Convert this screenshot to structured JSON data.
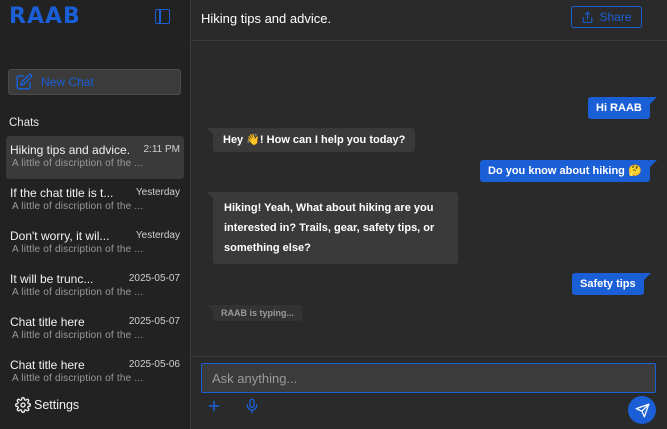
{
  "app": {
    "logo": "RAAB"
  },
  "sidebar": {
    "new_chat_label": "New Chat",
    "chats_heading": "Chats",
    "chats": [
      {
        "title": "Hiking tips and advice.",
        "time": "2:11 PM",
        "desc": "A little of discription of the ..."
      },
      {
        "title": "If the chat title is t...",
        "time": "Yesterday",
        "desc": "A little of discription of the ..."
      },
      {
        "title": "Don't worry, it wil...",
        "time": "Yesterday",
        "desc": "A little of discription of the ..."
      },
      {
        "title": "It will be trunc...",
        "time": "2025-05-07",
        "desc": "A little of discription of the ..."
      },
      {
        "title": "Chat title here",
        "time": "2025-05-07",
        "desc": "A little of discription of the ..."
      },
      {
        "title": "Chat title here",
        "time": "2025-05-06",
        "desc": "A little of discription of the ..."
      }
    ],
    "settings_label": "Settings"
  },
  "header": {
    "title": "Hiking tips and advice.",
    "share_label": "Share"
  },
  "messages": [
    {
      "role": "user",
      "text": "Hi RAAB"
    },
    {
      "role": "bot",
      "text": "Hey 👋! How can I help you today?"
    },
    {
      "role": "user",
      "text": "Do you know about hiking 🤔"
    },
    {
      "role": "bot",
      "text": "Hiking! Yeah, What about hiking are you interested in? Trails, gear, safety tips, or something else?"
    },
    {
      "role": "user",
      "text": "Safety tips"
    }
  ],
  "typing_indicator": "RAAB is typing...",
  "composer": {
    "placeholder": "Ask anything..."
  },
  "colors": {
    "accent": "#1a5fd6",
    "background": "#2a2a2a",
    "sidebar": "#222222",
    "bubble_bot": "#3a3a3a"
  },
  "icons": {
    "sidebar_toggle": "sidebar-toggle-icon",
    "new_chat": "edit-icon",
    "settings": "gear-icon",
    "share": "share-icon",
    "add": "plus-icon",
    "voice": "microphone-icon",
    "send": "send-icon"
  }
}
